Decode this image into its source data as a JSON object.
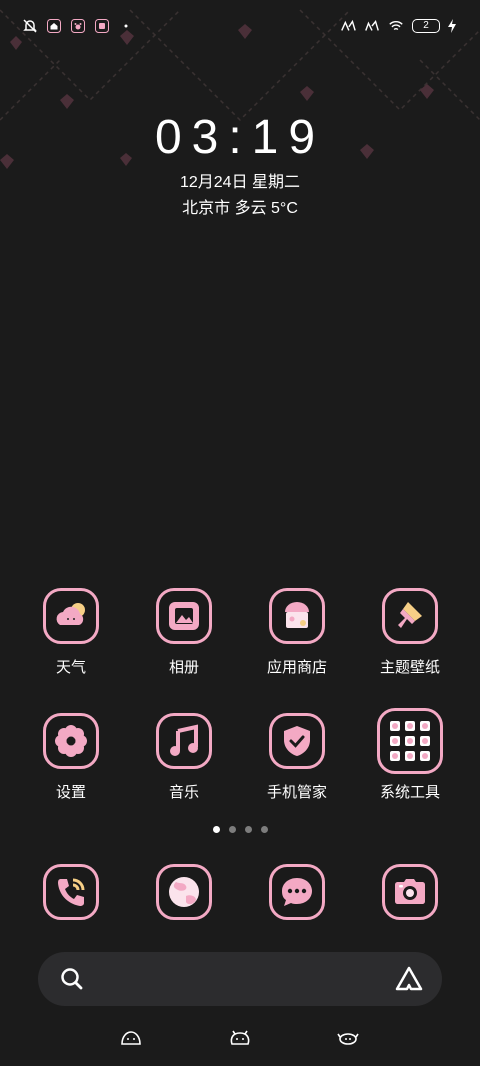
{
  "status_bar": {
    "left_icons": [
      "mute-bell-icon",
      "home-notif-icon",
      "paw-notif-icon",
      "photo-notif-icon",
      "dot-icon"
    ],
    "right_icons": [
      "signal-icon-1",
      "signal-icon-2",
      "wifi-icon"
    ],
    "battery_level": "2"
  },
  "lock": {
    "time": "03:19",
    "date": "12月24日 星期二",
    "weather": "北京市 多云 5°C"
  },
  "apps_row1": [
    {
      "label": "天气",
      "icon": "weather-cloud-icon"
    },
    {
      "label": "相册",
      "icon": "gallery-icon"
    },
    {
      "label": "应用商店",
      "icon": "app-store-icon"
    },
    {
      "label": "主题壁纸",
      "icon": "theme-brush-icon"
    }
  ],
  "apps_row2": [
    {
      "label": "设置",
      "icon": "settings-flower-icon"
    },
    {
      "label": "音乐",
      "icon": "music-note-icon"
    },
    {
      "label": "手机管家",
      "icon": "shield-check-icon"
    },
    {
      "label": "系统工具",
      "icon": "folder-grid-icon"
    }
  ],
  "page_indicator": {
    "count": 4,
    "active": 0
  },
  "dock": [
    "phone-icon",
    "browser-globe-icon",
    "messages-icon",
    "camera-icon"
  ],
  "colors": {
    "accent_pink": "#f3a9c4",
    "background": "#1b1b1b",
    "search_bg": "#2c2c2e"
  }
}
